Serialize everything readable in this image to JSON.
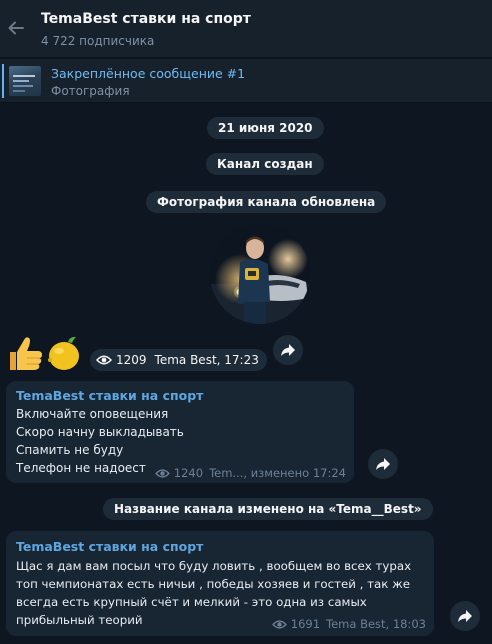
{
  "header": {
    "title": "TemaBest ставки на спорт",
    "subscribers": "4 722 подписчика"
  },
  "pinned": {
    "title": "Закреплённое сообщение #1",
    "subtitle": "Фотография"
  },
  "service": {
    "date": "21 июня 2020",
    "created": "Канал создан",
    "photo_updated": "Фотография канала обновлена",
    "renamed": "Название канала изменено на «Tema__Best»"
  },
  "emoji_post": {
    "emojis": [
      "👍",
      "🍋"
    ],
    "views": "1209",
    "author_time": "Tema Best, 17:23"
  },
  "post1": {
    "channel": "TemaBest ставки на спорт",
    "lines": [
      "Включайте оповещения",
      "Скоро начну выкладывать",
      "Спамить не буду",
      "Телефон не надоест"
    ],
    "views": "1240",
    "meta": "Tem..., изменено 17:24"
  },
  "post2": {
    "channel": "TemaBest ставки на спорт",
    "lines": [
      "Щас я дам вам посыл что буду ловить , вообщем во всех турах",
      "топ чемпионатах есть ничьи , победы хозяев и гостей , так же",
      "всегда есть крупный счёт и мелкий - это одна из самых",
      "прибыльный теорий"
    ],
    "views": "1691",
    "meta": "Tema Best, 18:03"
  },
  "icons": {
    "back": "arrow-left-icon",
    "views": "eye-icon",
    "share": "share-arrow-icon"
  },
  "colors": {
    "background": "#0e1621",
    "panel": "#17212b",
    "bubble": "#182533",
    "accent": "#5eb5f7"
  }
}
